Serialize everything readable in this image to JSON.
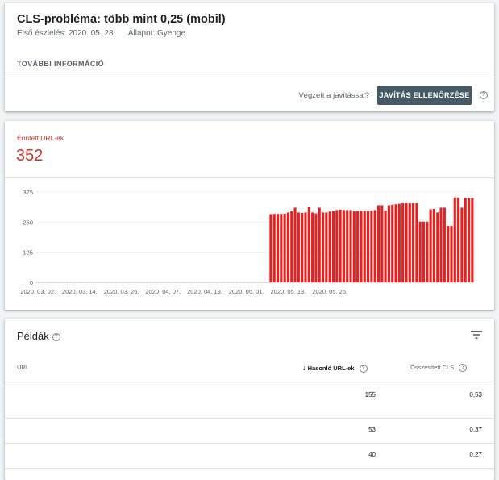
{
  "issue": {
    "title": "CLS-probléma: több mint 0,25 (mobil)",
    "first_detected_label": "Első észlelés:",
    "first_detected_value": "2020. 05. 28.",
    "status_label": "Állapot:",
    "status_value": "Gyenge",
    "more_info": "TOVÁBBI INFORMÁCIÓ",
    "done_question": "Végzett a javítással?",
    "validate_button": "JAVÍTÁS ELLENŐRZÉSE",
    "help_icon": "help-icon"
  },
  "affected": {
    "label": "Érintett URL-ek",
    "count": "352"
  },
  "colors": {
    "bar": "#ec1d1d",
    "accent_red": "#d93025",
    "button_bg": "#455a64"
  },
  "chart_data": {
    "type": "bar",
    "ylim": [
      0,
      375
    ],
    "yticks": [
      0,
      125,
      250,
      375
    ],
    "xtick_labels": [
      "2020. 03. 02.",
      "2020. 03. 14.",
      "2020. 03. 26.",
      "2020. 04. 07.",
      "2020. 04. 19.",
      "2020. 05. 01.",
      "2020. 05. 13.",
      "2020. 05. 25."
    ],
    "series": [
      {
        "values": [
          0,
          0,
          0,
          0,
          0,
          0,
          0,
          0,
          0,
          0,
          0,
          0,
          0,
          0,
          0,
          0,
          0,
          0,
          0,
          0,
          0,
          0,
          0,
          0,
          0,
          0,
          0,
          0,
          0,
          0,
          0,
          0,
          0,
          0,
          0,
          0,
          0,
          0,
          0,
          0,
          0,
          0,
          0,
          0,
          0,
          0,
          0,
          0,
          0,
          0,
          0,
          0,
          0,
          0,
          0,
          0,
          0,
          0,
          0,
          0,
          0,
          0,
          0,
          0,
          0,
          0,
          0,
          283,
          284,
          284,
          284,
          285,
          290,
          295,
          310,
          290,
          288,
          290,
          313,
          290,
          286,
          310,
          290,
          290,
          294,
          296,
          300,
          302,
          300,
          300,
          300,
          295,
          296,
          296,
          296,
          296,
          298,
          300,
          320,
          320,
          298,
          320,
          322,
          324,
          326,
          328,
          328,
          328,
          328,
          328,
          252,
          252,
          252,
          303,
          305,
          290,
          310,
          310,
          234,
          234,
          352,
          352,
          310,
          350,
          350,
          350
        ]
      }
    ]
  },
  "examples": {
    "title": "Példák",
    "filter_icon": "filter-icon",
    "columns": [
      "URL",
      "Hasonló URL-ek",
      "Összesített CLS"
    ],
    "sort_icon": "arrow-down-icon",
    "rows": [
      {
        "url": "",
        "similar": "155",
        "cls": "0,53"
      },
      {
        "url": "",
        "similar": "53",
        "cls": "0,37"
      },
      {
        "url": "",
        "similar": "40",
        "cls": "0,27"
      }
    ]
  }
}
